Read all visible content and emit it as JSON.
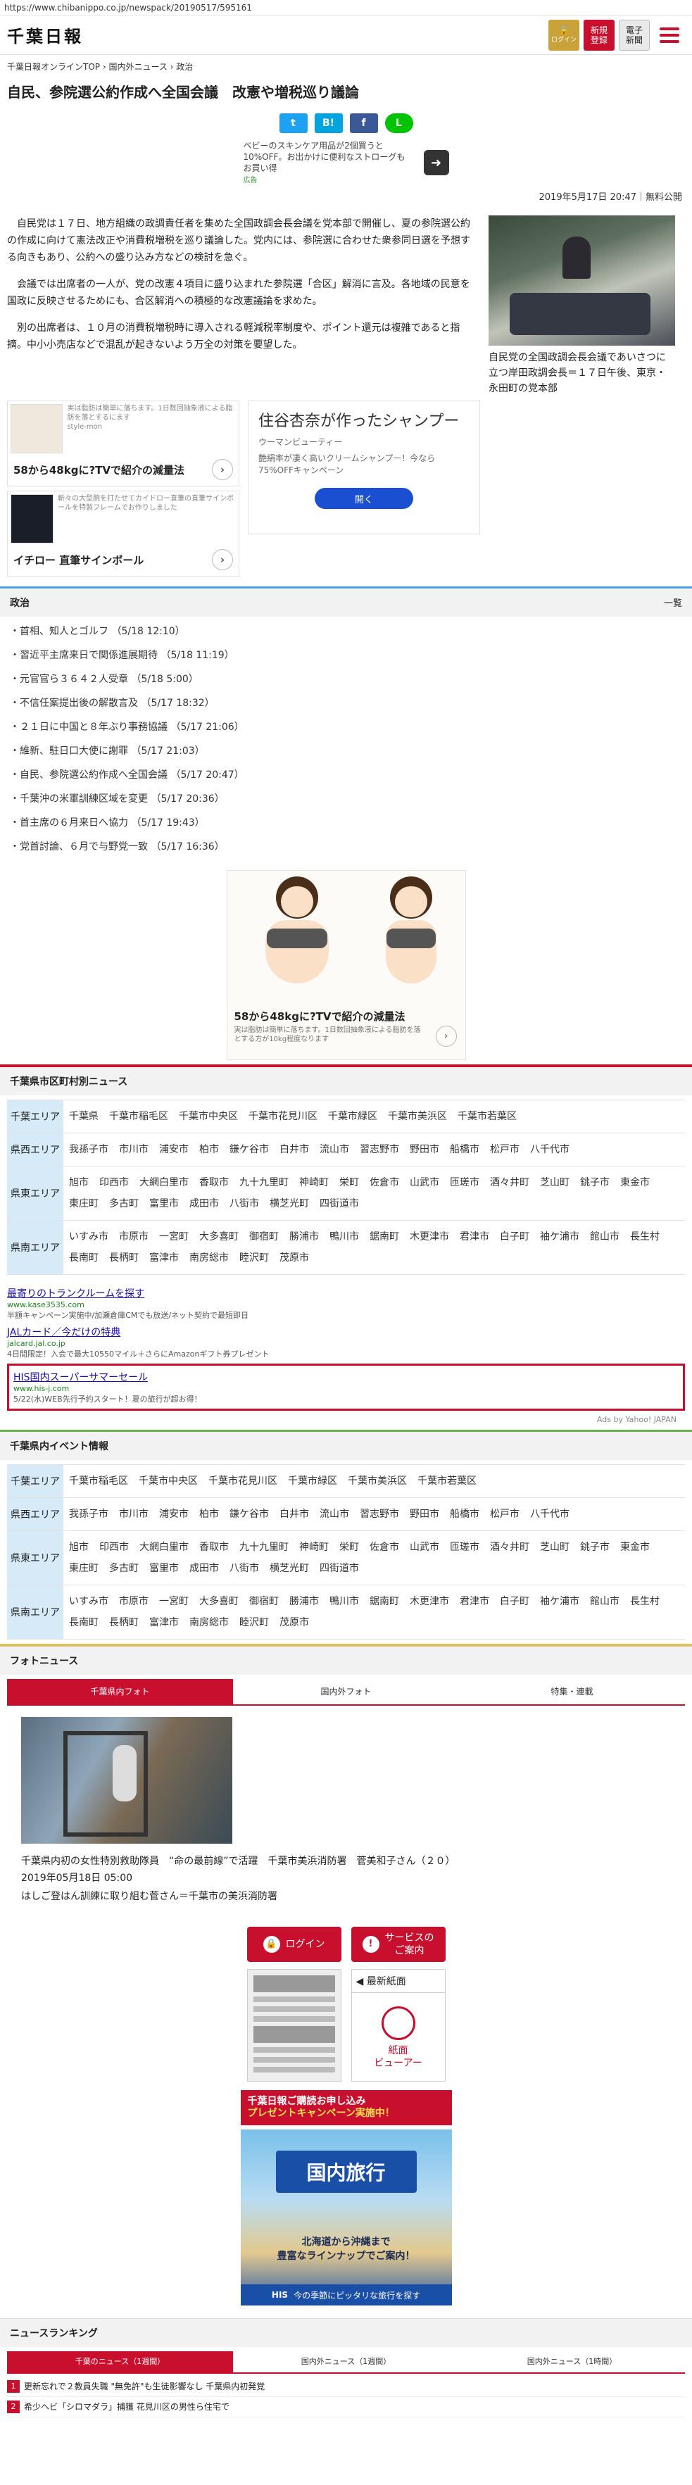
{
  "url": "https://www.chibanippo.co.jp/newspack/20190517/595161",
  "header": {
    "logo": "千葉日報",
    "login": "ログイン",
    "register_line1": "新規",
    "register_line2": "登録",
    "epaper_line1": "電子",
    "epaper_line2": "新聞"
  },
  "breadcrumb": "千葉日報オンラインTOP › 国内外ニュース › 政治",
  "article": {
    "title": "自民、参院選公約作成へ全国会議　改憲や増税巡り議論",
    "share": {
      "tw": "t",
      "hb": "B!",
      "fb": "f",
      "line": "L"
    },
    "promo_text": "ベビーのスキンケア用品が2個買うと10%OFF。お出かけに便利なストローグもお買い得",
    "promo_badge": "広告",
    "date": "2019年5月17日 20:47｜無料公開",
    "paragraphs": [
      "自民党は１７日、地方組織の政調責任者を集めた全国政調会長会議を党本部で開催し、夏の参院選公約の作成に向けて憲法改正や消費税増税を巡り議論した。党内には、参院選に合わせた衆参同日選を予想する向きもあり、公約への盛り込み方などの検討を急ぐ。",
      "会議では出席者の一人が、党の改憲４項目に盛り込まれた参院選「合区」解消に言及。各地域の民意を国政に反映させるためにも、合区解消への積極的な改憲議論を求めた。",
      "別の出席者は、１０月の消費税増税時に導入される軽減税率制度や、ポイント還元は複雑であると指摘。中小小売店などで混乱が起きないよう万全の対策を要望した。"
    ],
    "photo_caption": "自民党の全国政調会長会議であいさつに立つ岸田政調会長＝１７日午後、東京・永田町の党本部"
  },
  "ads": {
    "ad1_small": "実は脂肪は簡単に落ちます。1日数回抽象液による脂肪を落とするにます",
    "ad1_title": "58から48kgに?TVで紹介の減量法",
    "ad1_src": "style-mon",
    "ad2_small": "斬々の大型腕を打たせてカイドロー直筆の直筆サインボールを特製フレームでお作りしました",
    "ad2_title": "イチロー 直筆サインボール",
    "big_title": "住谷杏奈が作ったシャンプー",
    "big_src": "ウーマンビューティー",
    "big_sub": "艶絹率が凄く高いクリームシャンプー！今なら75%OFFキャンペーン",
    "big_btn": "開く"
  },
  "politics": {
    "header": "政治",
    "more": "一覧",
    "items": [
      "首相、知人とゴルフ （5/18 12:10）",
      "習近平主席来日で関係進展期待 （5/18 11:19）",
      "元官官ら３６４２人受章 （5/18 5:00）",
      "不信任案提出後の解散言及 （5/17 18:32）",
      "２１日に中国と８年ぶり事務協議 （5/17 21:06）",
      "維新、駐日口大使に謝罪 （5/17 21:03）",
      "自民、参院選公約作成へ全国会議 （5/17 20:47）",
      "千葉沖の米軍訓練区域を変更 （5/17 20:36）",
      "首主席の６月来日へ協力 （5/17 19:43）",
      "党首討論、６月で与野党一致 （5/17 16:36）"
    ]
  },
  "center_ad": {
    "title": "58から48kgに?TVで紹介の減量法",
    "sub": "実は脂肪は簡単に落ちます。1日数回抽象液による脂肪を落とする方が10kg程度なります",
    "src": "style-mon"
  },
  "municipal_news": {
    "header": "千葉県市区町村別ニュース",
    "areas": [
      {
        "label": "千葉エリア",
        "towns": [
          "千葉県",
          "千葉市稲毛区",
          "千葉市中央区",
          "千葉市花見川区",
          "千葉市緑区",
          "千葉市美浜区",
          "千葉市若葉区"
        ]
      },
      {
        "label": "県西エリア",
        "towns": [
          "我孫子市",
          "市川市",
          "浦安市",
          "柏市",
          "鎌ケ谷市",
          "白井市",
          "流山市",
          "習志野市",
          "野田市",
          "船橋市",
          "松戸市",
          "八千代市"
        ]
      },
      {
        "label": "県東エリア",
        "towns": [
          "旭市",
          "印西市",
          "大網白里市",
          "香取市",
          "九十九里町",
          "神崎町",
          "栄町",
          "佐倉市",
          "山武市",
          "匝瑳市",
          "酒々井町",
          "芝山町",
          "銚子市",
          "東金市",
          "東庄町",
          "多古町",
          "富里市",
          "成田市",
          "八街市",
          "横芝光町",
          "四街道市"
        ]
      },
      {
        "label": "県南エリア",
        "towns": [
          "いすみ市",
          "市原市",
          "一宮町",
          "大多喜町",
          "御宿町",
          "勝浦市",
          "鴨川市",
          "鋸南町",
          "木更津市",
          "君津市",
          "白子町",
          "袖ケ浦市",
          "館山市",
          "長生村",
          "長南町",
          "長柄町",
          "富津市",
          "南房総市",
          "睦沢町",
          "茂原市"
        ]
      }
    ]
  },
  "text_ads": [
    {
      "title": "最寄りのトランクルームを探す",
      "url": "www.kase3535.com",
      "desc": "半額キャンペーン実施中/加瀬倉庫CMでも放送/ネット契約で最短即日"
    },
    {
      "title": "JALカード／今だけの特典",
      "url": "jalcard.jal.co.jp",
      "desc": "4日間限定！入会で最大10550マイル＋さらにAmazonギフト券プレゼント"
    },
    {
      "title": "HIS国内スーパーサマーセール",
      "url": "www.his-j.com",
      "desc": "5/22(水)WEB先行予約スタート！夏の旅行が超お得！"
    }
  ],
  "ads_by": "Ads by Yahoo! JAPAN",
  "event_info": {
    "header": "千葉県内イベント情報",
    "areas": [
      {
        "label": "千葉エリア",
        "towns": [
          "千葉市稲毛区",
          "千葉市中央区",
          "千葉市花見川区",
          "千葉市緑区",
          "千葉市美浜区",
          "千葉市若葉区"
        ]
      },
      {
        "label": "県西エリア",
        "towns": [
          "我孫子市",
          "市川市",
          "浦安市",
          "柏市",
          "鎌ケ谷市",
          "白井市",
          "流山市",
          "習志野市",
          "野田市",
          "船橋市",
          "松戸市",
          "八千代市"
        ]
      },
      {
        "label": "県東エリア",
        "towns": [
          "旭市",
          "印西市",
          "大網白里市",
          "香取市",
          "九十九里町",
          "神崎町",
          "栄町",
          "佐倉市",
          "山武市",
          "匝瑳市",
          "酒々井町",
          "芝山町",
          "銚子市",
          "東金市",
          "東庄町",
          "多古町",
          "富里市",
          "成田市",
          "八街市",
          "横芝光町",
          "四街道市"
        ]
      },
      {
        "label": "県南エリア",
        "towns": [
          "いすみ市",
          "市原市",
          "一宮町",
          "大多喜町",
          "御宿町",
          "勝浦市",
          "鴨川市",
          "鋸南町",
          "木更津市",
          "君津市",
          "白子町",
          "袖ケ浦市",
          "館山市",
          "長生村",
          "長南町",
          "長柄町",
          "富津市",
          "南房総市",
          "睦沢町",
          "茂原市"
        ]
      }
    ]
  },
  "photo_news": {
    "header": "フォトニュース",
    "tabs": [
      "千葉県内フォト",
      "国内外フォト",
      "特集・連載"
    ],
    "title": "千葉県内初の女性特別救助隊員　“命の最前線”で活躍　千葉市美浜消防署　菅美和子さん（２０）",
    "date": "2019年05月18日 05:00",
    "desc": "はしご登はん訓練に取り組む菅さん＝千葉市の美浜消防署"
  },
  "services": {
    "login": "ログイン",
    "service_guide": "サービスの\nご案内",
    "latest_paper": "◀ 最新紙面",
    "viewer": "紙面\nビューアー"
  },
  "banners": {
    "b1_line1": "千葉日報ご購読お申し込み",
    "b1_line2": "プレゼントキャンペーン実施中！",
    "b2_title": "国内旅行",
    "b2_mid": "北海道から沖縄まで\n豊富なラインナップでご案内！",
    "b2_brand": "HIS",
    "b2_foot": "今の季節にピッタリな旅行を探す"
  },
  "ranking": {
    "header": "ニュースランキング",
    "tabs": [
      "千葉のニュース（1週間）",
      "国内外ニュース（1週間）",
      "国内外ニュース（1時間）"
    ],
    "items": [
      {
        "num": "1",
        "text": "更新忘れで２教員失職 \"無免許\"も生徒影響なし 千葉県内初発覚"
      },
      {
        "num": "2",
        "text": "希少ヘビ「シロマダラ」捕獲 花見川区の男性ら住宅で"
      }
    ]
  }
}
